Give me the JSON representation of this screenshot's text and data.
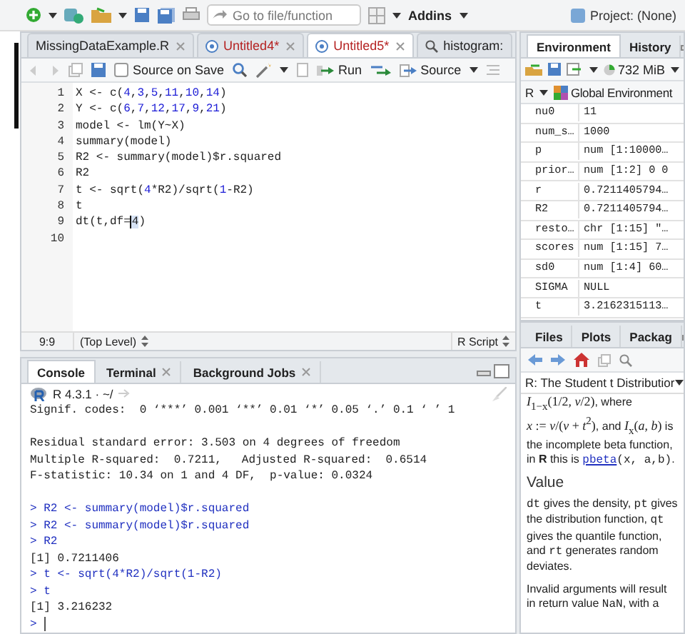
{
  "toolbar": {
    "goto_placeholder": "Go to file/function",
    "addins": "Addins",
    "project": "Project: (None)"
  },
  "editor": {
    "tabs": [
      {
        "label": "MissingDataExample.R",
        "selected": false,
        "modified": false,
        "kind": "file"
      },
      {
        "label": "Untitled4*",
        "selected": false,
        "modified": true,
        "kind": "file"
      },
      {
        "label": "Untitled5*",
        "selected": true,
        "modified": true,
        "kind": "file"
      },
      {
        "label": "histogram:",
        "selected": false,
        "modified": false,
        "kind": "search"
      }
    ],
    "source_on_save": {
      "label": "Source on Save",
      "checked": false
    },
    "run": "Run",
    "source": "Source",
    "lines": [
      {
        "number": "1",
        "segments": [
          {
            "text": "X <- c(",
            "kind": "plain"
          },
          {
            "text": "4",
            "kind": "num"
          },
          {
            "text": ",",
            "kind": "plain"
          },
          {
            "text": "3",
            "kind": "num"
          },
          {
            "text": ",",
            "kind": "plain"
          },
          {
            "text": "5",
            "kind": "num"
          },
          {
            "text": ",",
            "kind": "plain"
          },
          {
            "text": "11",
            "kind": "num"
          },
          {
            "text": ",",
            "kind": "plain"
          },
          {
            "text": "10",
            "kind": "num"
          },
          {
            "text": ",",
            "kind": "plain"
          },
          {
            "text": "14",
            "kind": "num"
          },
          {
            "text": ")",
            "kind": "plain"
          }
        ]
      },
      {
        "number": "2",
        "segments": [
          {
            "text": "Y <- c(",
            "kind": "plain"
          },
          {
            "text": "6",
            "kind": "num"
          },
          {
            "text": ",",
            "kind": "plain"
          },
          {
            "text": "7",
            "kind": "num"
          },
          {
            "text": ",",
            "kind": "plain"
          },
          {
            "text": "12",
            "kind": "num"
          },
          {
            "text": ",",
            "kind": "plain"
          },
          {
            "text": "17",
            "kind": "num"
          },
          {
            "text": ",",
            "kind": "plain"
          },
          {
            "text": "9",
            "kind": "num"
          },
          {
            "text": ",",
            "kind": "plain"
          },
          {
            "text": "21",
            "kind": "num"
          },
          {
            "text": ")",
            "kind": "plain"
          }
        ]
      },
      {
        "number": "3",
        "segments": [
          {
            "text": "model <- lm(Y~X)",
            "kind": "plain"
          }
        ]
      },
      {
        "number": "4",
        "segments": [
          {
            "text": "summary(model)",
            "kind": "plain"
          }
        ]
      },
      {
        "number": "5",
        "segments": [
          {
            "text": "R2 <- summary(model)$r.squared",
            "kind": "plain"
          }
        ]
      },
      {
        "number": "6",
        "segments": [
          {
            "text": "R2",
            "kind": "plain"
          }
        ]
      },
      {
        "number": "7",
        "segments": [
          {
            "text": "t <- sqrt(",
            "kind": "plain"
          },
          {
            "text": "4",
            "kind": "num"
          },
          {
            "text": "*R2)/sqrt(",
            "kind": "plain"
          },
          {
            "text": "1",
            "kind": "num"
          },
          {
            "text": "-R2)",
            "kind": "plain"
          }
        ]
      },
      {
        "number": "8",
        "segments": [
          {
            "text": "t",
            "kind": "plain"
          }
        ]
      },
      {
        "number": "9",
        "segments": [
          {
            "text": "dt(t,df=",
            "kind": "plain"
          },
          {
            "text": "4",
            "kind": "cursor"
          },
          {
            "text": ")",
            "kind": "plain"
          }
        ]
      },
      {
        "number": "10"
      }
    ],
    "status": {
      "position": "9:9",
      "scope": "(Top Level)",
      "filetype": "R Script"
    }
  },
  "console": {
    "tabs": [
      {
        "label": "Console",
        "selected": true,
        "closable": false
      },
      {
        "label": "Terminal",
        "selected": false,
        "closable": true
      },
      {
        "label": "Background Jobs",
        "selected": false,
        "closable": true
      }
    ],
    "path": "R 4.3.1 · ~/",
    "lines": [
      {
        "text": "Signif. codes:  0 ‘***’ 0.001 ‘**’ 0.01 ‘*’ 0.05 ‘.’ 0.1 ‘ ’ 1",
        "kind": "output"
      },
      {
        "kind": "blank"
      },
      {
        "text": "Residual standard error: 3.503 on 4 degrees of freedom",
        "kind": "output"
      },
      {
        "text": "Multiple R-squared:  0.7211,\tAdjusted R-squared:  0.6514",
        "kind": "output"
      },
      {
        "text": "F-statistic: 10.34 on 1 and 4 DF,  p-value: 0.0324",
        "kind": "output"
      },
      {
        "kind": "blank"
      },
      {
        "text": "> R2 <- summary(model)$r.squared",
        "kind": "input"
      },
      {
        "text": "> R2 <- summary(model)$r.squared",
        "kind": "input"
      },
      {
        "text": "> R2",
        "kind": "input"
      },
      {
        "text": "[1] 0.7211406",
        "kind": "output"
      },
      {
        "text": "> t <- sqrt(4*R2)/sqrt(1-R2)",
        "kind": "input"
      },
      {
        "text": "> t",
        "kind": "input"
      },
      {
        "text": "[1] 3.216232",
        "kind": "output"
      },
      {
        "text": ">",
        "kind": "prompt"
      }
    ]
  },
  "environment": {
    "tabs": [
      {
        "label": "Environment",
        "selected": true
      },
      {
        "label": "History",
        "selected": false
      }
    ],
    "memory": "732 MiB",
    "language": "R",
    "scope": "Global Environment",
    "rows": [
      {
        "name": "nu0",
        "value": "11"
      },
      {
        "name": "num_s…",
        "value": "1000"
      },
      {
        "name": "p",
        "value": "num [1:10000…"
      },
      {
        "name": "prior…",
        "value": "num [1:2] 0 0"
      },
      {
        "name": "r",
        "value": "0.7211405794…"
      },
      {
        "name": "R2",
        "value": "0.7211405794…"
      },
      {
        "name": "resto…",
        "value": "chr [1:15] \"…"
      },
      {
        "name": "scores",
        "value": "num [1:15] 7…"
      },
      {
        "name": "sd0",
        "value": "num [1:4] 60…"
      },
      {
        "name": "SIGMA",
        "value": "NULL"
      },
      {
        "name": "t",
        "value": "3.2162315113…"
      }
    ]
  },
  "help_pane": {
    "tabs": [
      {
        "label": "Files",
        "selected": false
      },
      {
        "label": "Plots",
        "selected": false
      },
      {
        "label": "Packag",
        "selected": false
      }
    ],
    "topic": "R: The Student t Distributior",
    "blocks": [
      {
        "kind": "para",
        "segments": [
          {
            "text": "*I*$_{1−x}$(1/2, *ν*/2)",
            "kind": "math"
          },
          {
            "text": ", where ",
            "kind": "text"
          },
          {
            "text": "*x* := *ν*/(*ν* + *t*$^{2}$)",
            "kind": "math"
          },
          {
            "text": ", and ",
            "kind": "text"
          },
          {
            "text": "*I*$_{x}$(*a*, *b*)",
            "kind": "math"
          },
          {
            "text": " is the incomplete beta function, in **R** this is ",
            "kind": "text"
          },
          {
            "text": "pbeta",
            "kind": "link"
          },
          {
            "text": "(x, a,b)",
            "kind": "code"
          },
          {
            "text": ".",
            "kind": "text"
          }
        ]
      },
      {
        "kind": "heading",
        "segments": [
          {
            "text": "Value",
            "kind": "text"
          }
        ]
      },
      {
        "kind": "para",
        "segments": [
          {
            "text": "dt",
            "kind": "code"
          },
          {
            "text": " gives the density, ",
            "kind": "text"
          },
          {
            "text": "pt",
            "kind": "code"
          },
          {
            "text": " gives the distribution function, ",
            "kind": "text"
          },
          {
            "text": "qt",
            "kind": "code"
          },
          {
            "text": " gives the quantile function, and ",
            "kind": "text"
          },
          {
            "text": "rt",
            "kind": "code"
          },
          {
            "text": " generates random deviates.",
            "kind": "text"
          }
        ]
      },
      {
        "kind": "para",
        "segments": [
          {
            "text": "Invalid arguments will result in return value ",
            "kind": "text"
          },
          {
            "text": "NaN",
            "kind": "code"
          },
          {
            "text": ", with a",
            "kind": "text"
          }
        ]
      }
    ]
  }
}
